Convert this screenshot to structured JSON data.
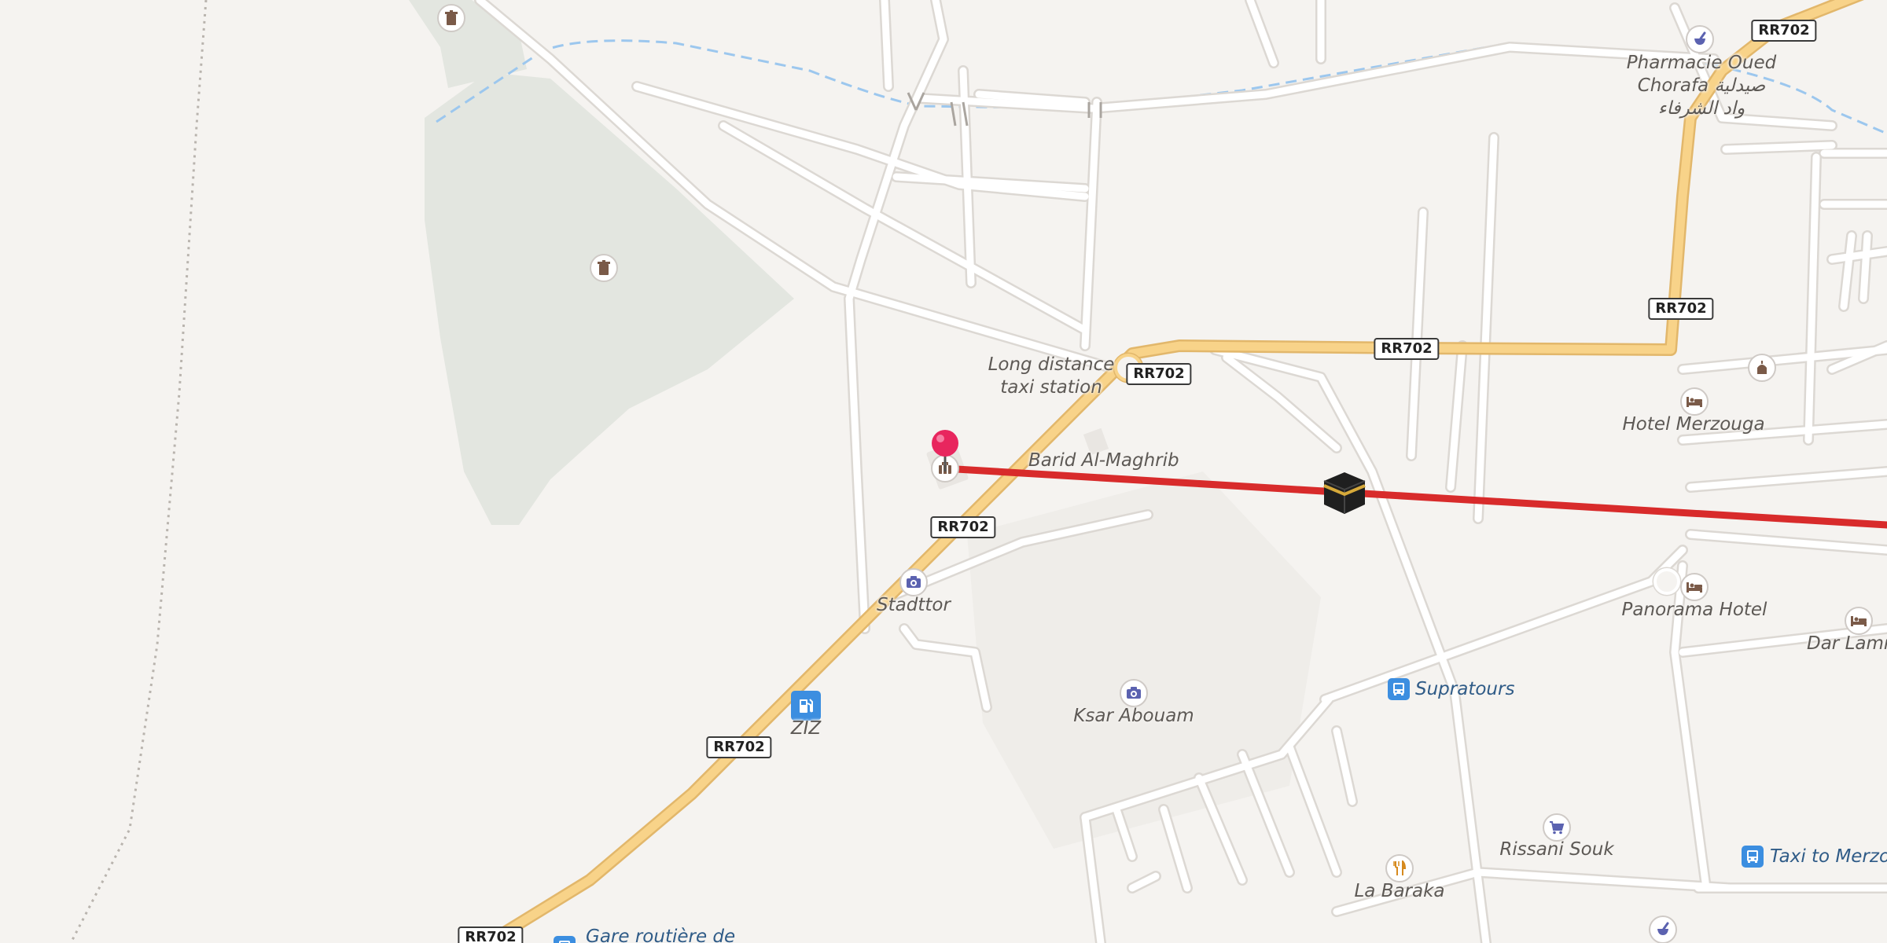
{
  "map": {
    "colors": {
      "background": "#f5f3f0",
      "park": "#e3e6e0",
      "road_minor": "#ffffff",
      "road_major": "#f8d389",
      "waterway": "#9cc7ee",
      "route": "#d82b2b",
      "pin": "#e8265e",
      "bus_stop": "#3c8ee0",
      "restaurant": "#d68a1e",
      "attraction": "#5b62b0",
      "pharmacy": "#5b62b0",
      "hotel": "#7a5a48"
    },
    "road_labels": [
      "RR702",
      "RR702",
      "RR702",
      "RR702",
      "RR702",
      "RR702",
      "RR702",
      "RR702"
    ],
    "labels": {
      "taxi_station": "Long distance\ntaxi station",
      "barid": "Barid Al-Maghrib",
      "stadttor": "Stadttor",
      "ziz": "ZIZ",
      "ksar": "Ksar Abouam",
      "supratours": "Supratours",
      "la_baraka": "La Baraka",
      "rissani_souk": "Rissani Souk",
      "taxi_merzouga": "Taxi to Merzou",
      "hotel_merzouga": "Hotel Merzouga",
      "panorama_hotel": "Panorama Hotel",
      "dar_lamrani": "Dar Lamra",
      "pharmacie": "Pharmacie Oued\nChorafa صيدلية\nواد الشرفاء",
      "gare": "Gare routière de"
    },
    "icons": {
      "pin": "location-pin-icon",
      "kaaba": "kaaba-icon",
      "camera": "camera-icon",
      "fuel": "fuel-station-icon",
      "bus": "bus-icon",
      "restaurant": "fork-knife-icon",
      "shop": "shopping-cart-icon",
      "hotel": "bed-icon",
      "pharmacy": "mortar-pestle-icon",
      "waste": "waste-basket-icon",
      "mosque": "mosque-icon",
      "luggage": "luggage-icon"
    }
  }
}
